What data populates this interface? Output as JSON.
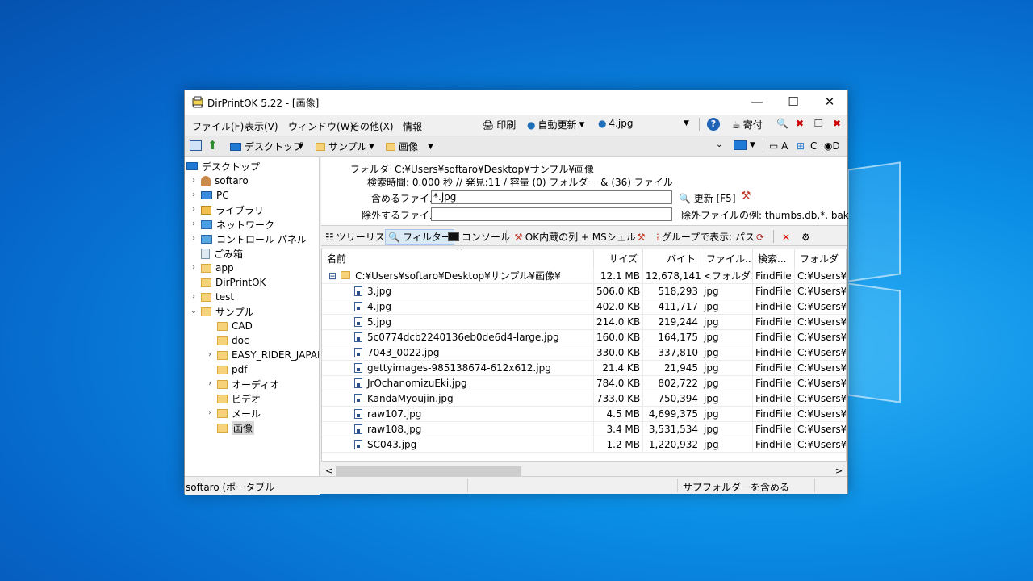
{
  "window": {
    "title": "DirPrintOK 5.22 - [画像]"
  },
  "titlebar": {
    "minimize": "—",
    "maximize": "☐",
    "close": "✕"
  },
  "menu": [
    "ファイル(F)",
    "表示(V)",
    "ウィンドウ(W)",
    "その他(X)",
    "情報"
  ],
  "toolbar": {
    "print_label": "印刷",
    "auto_update_label": "自動更新",
    "file_combo_value": "4.jpg",
    "donate_label": "寄付"
  },
  "address": {
    "crumbs": [
      "デスクトップ",
      "サンプル",
      "画像"
    ],
    "drives": [
      "A",
      "C",
      "D"
    ]
  },
  "tree": {
    "items": [
      {
        "label": "デスクトップ",
        "icon": "desktop-icon"
      },
      {
        "label": "softaro",
        "icon": "user-icon"
      },
      {
        "label": "PC",
        "icon": "pc-icon"
      },
      {
        "label": "ライブラリ",
        "icon": "library-icon"
      },
      {
        "label": "ネットワーク",
        "icon": "network-icon"
      },
      {
        "label": "コントロール パネル",
        "icon": "control-panel-icon"
      },
      {
        "label": "ごみ箱",
        "icon": "recycle-bin-icon"
      },
      {
        "label": "app",
        "icon": "folder-icon"
      },
      {
        "label": "DirPrintOK",
        "icon": "folder-icon"
      },
      {
        "label": "test",
        "icon": "folder-icon"
      },
      {
        "label": "サンプル",
        "icon": "folder-icon"
      },
      {
        "label": "CAD",
        "icon": "folder-icon"
      },
      {
        "label": "doc",
        "icon": "folder-icon"
      },
      {
        "label": "EASY_RIDER_JAPAN",
        "icon": "folder-icon"
      },
      {
        "label": "pdf",
        "icon": "folder-icon"
      },
      {
        "label": "オーディオ",
        "icon": "folder-icon"
      },
      {
        "label": "ビデオ",
        "icon": "folder-icon"
      },
      {
        "label": "メール",
        "icon": "folder-icon"
      },
      {
        "label": "画像",
        "icon": "folder-icon"
      }
    ]
  },
  "info": {
    "folder_label": "フォルダー",
    "folder_path": "C:¥Users¥softaro¥Desktop¥サンプル¥画像",
    "search_stats": "検索時間: 0.000 秒 //  発見:11 / 容量 (0) フォルダー & (36) ファイル",
    "include_label": "含めるファイル",
    "include_value": "*.jpg",
    "update_label": "更新 [F5]",
    "exclude_label": "除外するファイル",
    "exclude_value": "",
    "exclude_hint": "除外ファイルの例: thumbs.db,*. bak"
  },
  "tabs": {
    "tree_list": "ツリーリスト",
    "filter": "フィルター",
    "console": "コンソール",
    "ok_columns": "OK内蔵の列 + MSシェル",
    "group_by": "グループで表示: パス"
  },
  "table": {
    "headers": [
      "名前",
      "サイズ",
      "バイト",
      "ファイル...",
      "検索...",
      "フォルダ"
    ],
    "root": {
      "name": "C:¥Users¥softaro¥Desktop¥サンプル¥画像¥",
      "size": "12.1 MB",
      "bytes": "12,678,141",
      "type": "<フォルダ>",
      "search": "FindFile",
      "folder": "C:¥Users¥so"
    },
    "rows": [
      {
        "name": "3.jpg",
        "size": "506.0 KB",
        "bytes": "518,293",
        "type": "jpg",
        "search": "FindFile",
        "folder": "C:¥Users¥so"
      },
      {
        "name": "4.jpg",
        "size": "402.0 KB",
        "bytes": "411,717",
        "type": "jpg",
        "search": "FindFile",
        "folder": "C:¥Users¥so"
      },
      {
        "name": "5.jpg",
        "size": "214.0 KB",
        "bytes": "219,244",
        "type": "jpg",
        "search": "FindFile",
        "folder": "C:¥Users¥so"
      },
      {
        "name": "5c0774dcb2240136eb0de6d4-large.jpg",
        "size": "160.0 KB",
        "bytes": "164,175",
        "type": "jpg",
        "search": "FindFile",
        "folder": "C:¥Users¥so"
      },
      {
        "name": "7043_0022.jpg",
        "size": "330.0 KB",
        "bytes": "337,810",
        "type": "jpg",
        "search": "FindFile",
        "folder": "C:¥Users¥so"
      },
      {
        "name": "gettyimages-985138674-612x612.jpg",
        "size": "21.4 KB",
        "bytes": "21,945",
        "type": "jpg",
        "search": "FindFile",
        "folder": "C:¥Users¥so"
      },
      {
        "name": "JrOchanomizuEki.jpg",
        "size": "784.0 KB",
        "bytes": "802,722",
        "type": "jpg",
        "search": "FindFile",
        "folder": "C:¥Users¥so"
      },
      {
        "name": "KandaMyoujin.jpg",
        "size": "733.0 KB",
        "bytes": "750,394",
        "type": "jpg",
        "search": "FindFile",
        "folder": "C:¥Users¥so"
      },
      {
        "name": "raw107.jpg",
        "size": "4.5 MB",
        "bytes": "4,699,375",
        "type": "jpg",
        "search": "FindFile",
        "folder": "C:¥Users¥so"
      },
      {
        "name": "raw108.jpg",
        "size": "3.4 MB",
        "bytes": "3,531,534",
        "type": "jpg",
        "search": "FindFile",
        "folder": "C:¥Users¥so"
      },
      {
        "name": "SC043.jpg",
        "size": "1.2 MB",
        "bytes": "1,220,932",
        "type": "jpg",
        "search": "FindFile",
        "folder": "C:¥Users¥so"
      }
    ]
  },
  "status": {
    "left": "softaro (ポータブル",
    "right": "サブフォルダーを含める"
  },
  "colors": {
    "desktop": "#0a8fe6",
    "tab_active": "#dbe9f7",
    "folder": "#f6d27a"
  }
}
